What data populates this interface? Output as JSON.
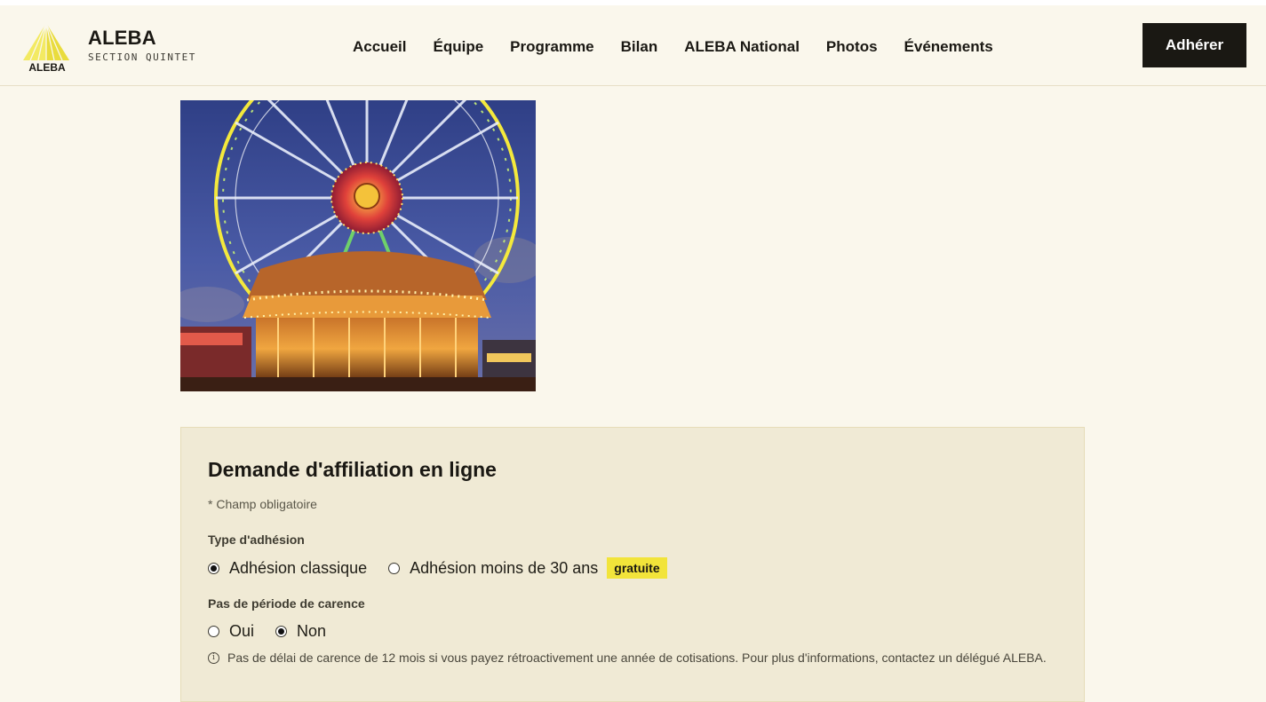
{
  "brand": {
    "logo_text": "ALEBA",
    "name": "ALEBA",
    "subtitle": "SECTION QUINTET"
  },
  "nav": [
    "Accueil",
    "Équipe",
    "Programme",
    "Bilan",
    "ALEBA National",
    "Photos",
    "Événements"
  ],
  "header": {
    "cta_label": "Adhérer"
  },
  "hero_image": {
    "icon": "ferris-wheel-carousel-photo"
  },
  "form": {
    "title": "Demande d'affiliation en ligne",
    "required_note": "* Champ obligatoire",
    "membership_type": {
      "label": "Type d'adhésion",
      "options": [
        "Adhésion classique",
        "Adhésion moins de 30 ans"
      ],
      "selected": "Adhésion classique",
      "badge": "gratuite"
    },
    "waiting_period": {
      "label": "Pas de période de carence",
      "options": [
        "Oui",
        "Non"
      ],
      "selected": "Non"
    },
    "info_text": "Pas de délai de carence de 12 mois si vous payez rétroactivement une année de cotisations. Pour plus d'informations, contactez un délégué ALEBA."
  },
  "colors": {
    "background": "#faf7ec",
    "card": "#f0ead5",
    "accent_yellow": "#f2e43a",
    "dark": "#1a1813"
  }
}
